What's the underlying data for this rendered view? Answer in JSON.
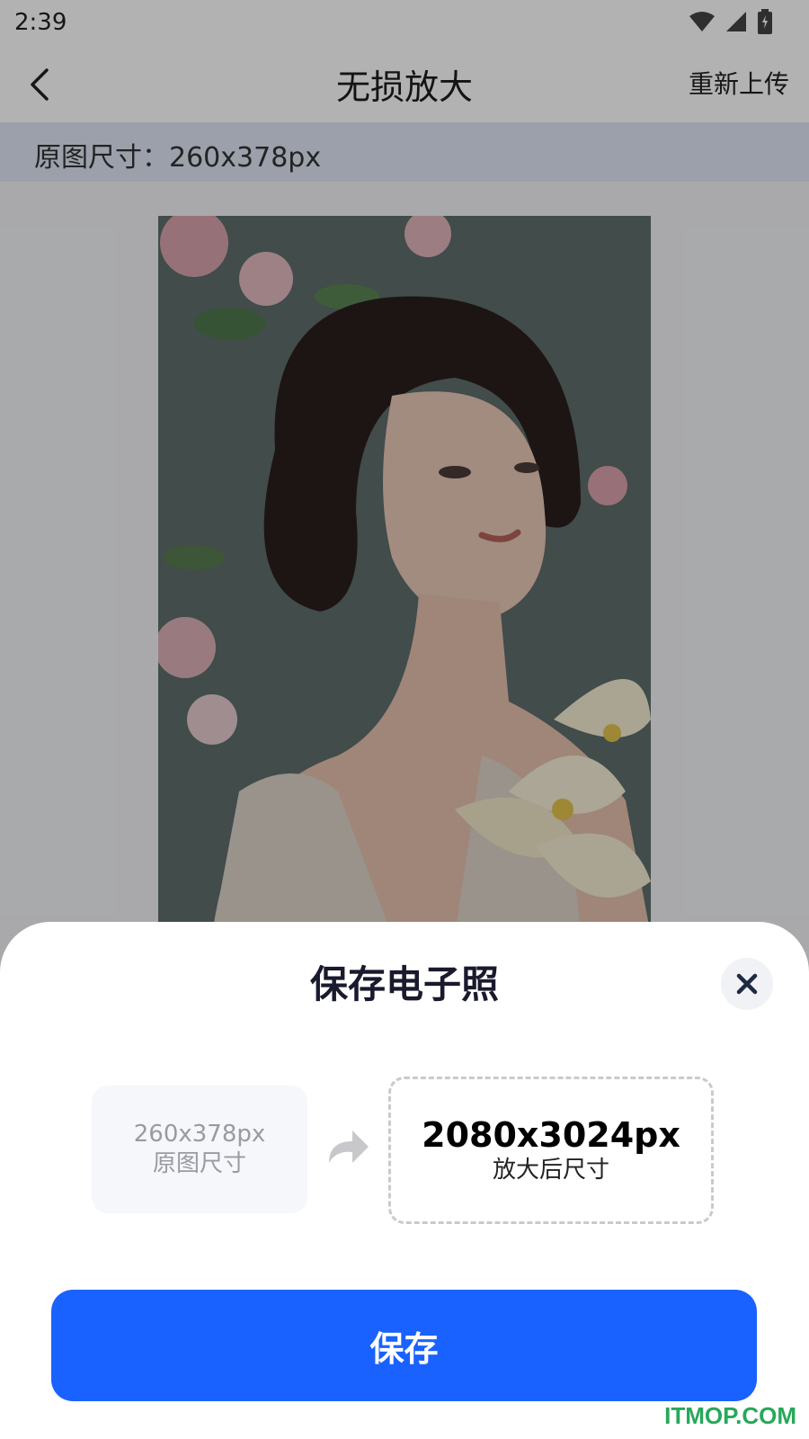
{
  "status_bar": {
    "time": "2:39"
  },
  "app_bar": {
    "title": "无损放大",
    "reupload_label": "重新上传"
  },
  "info_bar": {
    "original_size_label": "原图尺寸：260x378px"
  },
  "sheet": {
    "title": "保存电子照",
    "original": {
      "size": "260x378px",
      "caption": "原图尺寸"
    },
    "enlarged": {
      "size": "2080x3024px",
      "caption": "放大后尺寸"
    },
    "save_label": "保存"
  },
  "watermark": "ITMOP.COM",
  "colors": {
    "primary": "#1a62ff",
    "infobar": "#dfe6f5",
    "watermark": "#27a85a"
  },
  "icons": {
    "back": "chevron-left-icon",
    "close": "close-icon",
    "arrow": "curved-arrow-right-icon",
    "wifi": "wifi-icon",
    "signal": "signal-icon",
    "battery": "battery-icon"
  }
}
